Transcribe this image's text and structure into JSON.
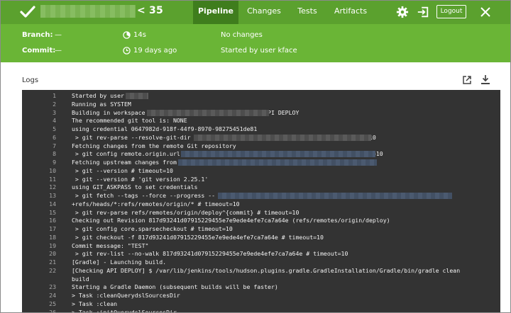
{
  "header": {
    "run_number": "< 35",
    "tabs": [
      {
        "label": "Pipeline",
        "active": true
      },
      {
        "label": "Changes",
        "active": false
      },
      {
        "label": "Tests",
        "active": false
      },
      {
        "label": "Artifacts",
        "active": false
      }
    ],
    "logout_label": "Logout"
  },
  "summary": {
    "branch_label": "Branch:",
    "branch_value": "—",
    "commit_label": "Commit:",
    "commit_value": "—",
    "duration": "14s",
    "time_ago": "19 days ago",
    "changes": "No changes",
    "started_by": "Started by user kface"
  },
  "logs": {
    "title": "Logs",
    "lines": [
      {
        "n": "1",
        "t": "Started by user"
      },
      {
        "n": "2",
        "t": "Running as SYSTEM"
      },
      {
        "n": "3",
        "t": "Building in workspace                                  API DEPLOY"
      },
      {
        "n": "4",
        "t": "The recommended git tool is: NONE"
      },
      {
        "n": "5",
        "t": "using credential 0647982d-918f-44f9-8970-98275451de81"
      },
      {
        "n": "6",
        "t": " > git rev-parse --resolve-git-dir                                         # timeout=10"
      },
      {
        "n": "7",
        "t": "Fetching changes from the remote Git repository"
      },
      {
        "n": "8",
        "t": " > git config remote.origin.url                                              # timeout=10"
      },
      {
        "n": "9",
        "t": "Fetching upstream changes from"
      },
      {
        "n": "10",
        "t": " > git --version # timeout=10"
      },
      {
        "n": "11",
        "t": " > git --version # 'git version 2.25.1'"
      },
      {
        "n": "12",
        "t": "using GIT_ASKPASS to set credentials"
      },
      {
        "n": "13",
        "t": " > git fetch --tags --force --progress --"
      },
      {
        "n": "14",
        "t": "+refs/heads/*:refs/remotes/origin/* # timeout=10"
      },
      {
        "n": "15",
        "t": " > git rev-parse refs/remotes/origin/deploy^{commit} # timeout=10"
      },
      {
        "n": "16",
        "t": "Checking out Revision 817d93241d0791522945​5e7e9ede4efe7ca7a64e (refs/remotes/origin/deploy)"
      },
      {
        "n": "17",
        "t": " > git config core.sparsecheckout # timeout=10"
      },
      {
        "n": "18",
        "t": " > git checkout -f 817d93241d07915229455e7e9ede4efe7ca7a64e # timeout=10"
      },
      {
        "n": "19",
        "t": "Commit message: \"TEST\""
      },
      {
        "n": "20",
        "t": " > git rev-list --no-walk 817d93241d07915229455e7e9ede4efe7ca7a64e # timeout=10"
      },
      {
        "n": "21",
        "t": "[Gradle] - Launching build."
      },
      {
        "n": "22",
        "t": "[Checking API DEPLOY] $ /var/lib/jenkins/tools/hudson.plugins.gradle.GradleInstallation/Gradle/bin/gradle clean"
      },
      {
        "n": "",
        "t": "build"
      },
      {
        "n": "23",
        "t": "Starting a Gradle Daemon (subsequent builds will be faster)"
      },
      {
        "n": "24",
        "t": "> Task :cleanQuerydslSourcesDir"
      },
      {
        "n": "25",
        "t": "> Task :clean"
      },
      {
        "n": "26",
        "t": "> Task :initQuerydslSourcesDir"
      }
    ]
  }
}
